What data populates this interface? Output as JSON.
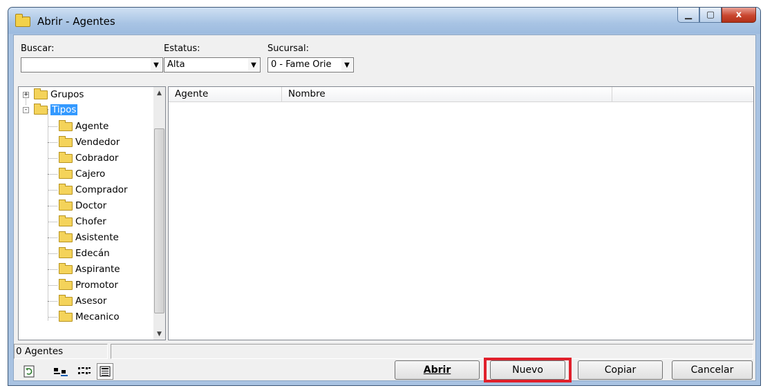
{
  "window": {
    "title": "Abrir - Agentes",
    "controls": {
      "minimize": "▁",
      "maximize": "▢",
      "close": "x"
    }
  },
  "filters": {
    "buscar_label": "Buscar:",
    "buscar_value": "",
    "estatus_label": "Estatus:",
    "estatus_value": "Alta",
    "sucursal_label": "Sucursal:",
    "sucursal_value": "0 - Fame Orie"
  },
  "tree": {
    "root_items": [
      {
        "label": "Grupos",
        "expander": "+"
      },
      {
        "label": "Tipos",
        "expander": "-"
      }
    ],
    "children": [
      "Agente",
      "Vendedor",
      "Cobrador",
      "Cajero",
      "Comprador",
      "Doctor",
      "Chofer",
      "Asistente",
      "Edecán",
      "Aspirante",
      "Promotor",
      "Asesor",
      "Mecanico"
    ]
  },
  "grid": {
    "columns": [
      "Agente",
      "Nombre"
    ]
  },
  "status": {
    "count_text": "0 Agentes"
  },
  "buttons": {
    "abrir": "Abrir",
    "nuevo": "Nuevo",
    "copiar": "Copiar",
    "cancelar": "Cancelar"
  },
  "icons": [
    "refresh-icon",
    "large-icons-view-icon",
    "small-icons-view-icon",
    "details-view-icon"
  ],
  "colors": {
    "highlight": "#e0202b",
    "selection": "#3399ff"
  }
}
